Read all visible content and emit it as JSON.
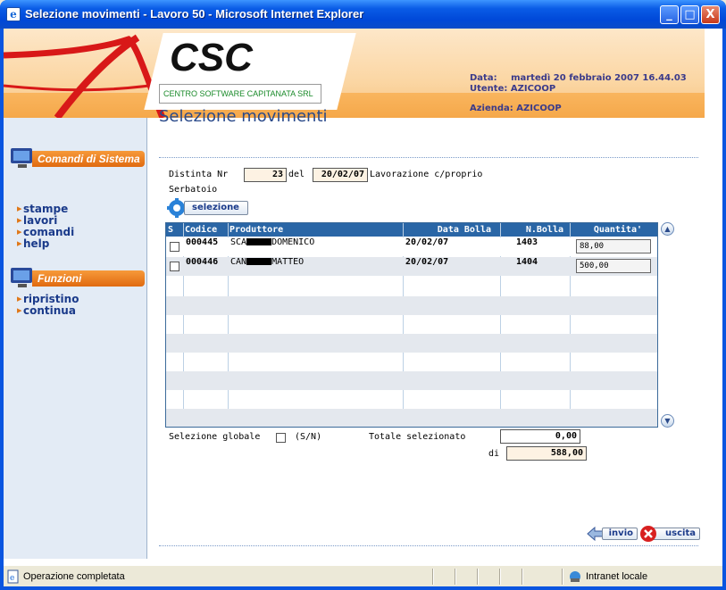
{
  "window": {
    "title": "Selezione movimenti - Lavoro 50 - Microsoft Internet Explorer",
    "controls": [
      "_",
      "□",
      "X"
    ]
  },
  "header": {
    "logo_text": "CSC",
    "logo_subtitle": "CENTRO SOFTWARE CAPITANATA SRL",
    "data_label": "Data:",
    "data_value": "martedì 20 febbraio 2007 16.44.03",
    "utente_label": "Utente:",
    "utente_value": "AZICOOP",
    "azienda_label": "Azienda:",
    "azienda_value": "AZICOOP"
  },
  "sidebar": {
    "sections": [
      {
        "title": "Comandi di Sistema",
        "items": [
          "stampe",
          "lavori",
          "comandi",
          "help"
        ]
      },
      {
        "title": "Funzioni",
        "items": [
          "ripristino",
          "continua"
        ]
      }
    ]
  },
  "main": {
    "title": "Selezione movimenti",
    "distinta_label": "Distinta Nr",
    "distinta_value": "23",
    "del_label": "del",
    "del_value": "20/02/07",
    "lavorazione_label": "Lavorazione c/proprio",
    "serbatoio_label": "Serbatoio",
    "selezione_button": "selezione"
  },
  "grid": {
    "columns": [
      "S",
      "Codice",
      "Produttore",
      "Data Bolla",
      "N.Bolla",
      "Quantita'"
    ],
    "rows": [
      {
        "codice": "000445",
        "produttore_pre": "SCA",
        "produttore_post": "DOMENICO",
        "data_bolla": "20/02/07",
        "n_bolla": "1403",
        "quantita": "88,00"
      },
      {
        "codice": "000446",
        "produttore_pre": "CAN",
        "produttore_post": "MATTEO",
        "data_bolla": "20/02/07",
        "n_bolla": "1404",
        "quantita": "500,00"
      }
    ]
  },
  "footer": {
    "selezione_globale_label": "Selezione globale",
    "sn_label": "(S/N)",
    "totale_label": "Totale selezionato",
    "totale_value": "0,00",
    "di_label": "di",
    "di_value": "588,00",
    "invio_button": "invio",
    "uscita_button": "uscita"
  },
  "statusbar": {
    "status_text": "Operazione completata",
    "zone_text": "Intranet locale"
  },
  "colors": {
    "title_blue": "#0a5ce6",
    "header_orange": "#f5a84a",
    "grid_header": "#2a66a6",
    "sidebar_bg": "#e3ebf5"
  }
}
